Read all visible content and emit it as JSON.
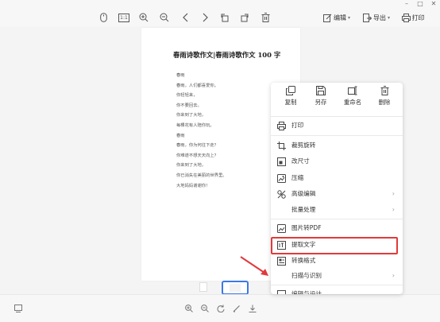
{
  "window": {
    "minimize": "–",
    "maximize": "□",
    "close": "✕"
  },
  "toolbar": {
    "zoom_ratio_label": "1:1",
    "edit_label": "编辑",
    "export_label": "导出",
    "print_label": "打印"
  },
  "document": {
    "title": "春雨诗歌作文|春雨诗歌作文 100 字",
    "poem_lines": [
      "春雨",
      "春雨，人们都喜爱你。",
      "你轻轻来，",
      "你不要回去。",
      "你来到了大地，",
      "每棵花有人陪你玩。",
      "春雨",
      "春雨，你为何往下走？",
      "你难道不想天天向上？",
      "你来到了大地，",
      "你已消失在美丽的世界里。",
      "大地妈妈谢谢你！"
    ]
  },
  "context_menu": {
    "quick_actions": [
      {
        "label": "复制",
        "icon": "copy-icon"
      },
      {
        "label": "另存",
        "icon": "save-icon"
      },
      {
        "label": "重命名",
        "icon": "rename-icon"
      },
      {
        "label": "删除",
        "icon": "trash-icon"
      }
    ],
    "items": [
      {
        "label": "打印",
        "icon": "printer-icon",
        "submenu": false
      },
      {
        "label": "裁剪旋转",
        "icon": "crop-icon",
        "submenu": false
      },
      {
        "label": "改尺寸",
        "icon": "resize-icon",
        "submenu": false
      },
      {
        "label": "压缩",
        "icon": "compress-icon",
        "submenu": false
      },
      {
        "label": "高级编辑",
        "icon": "advanced-edit-icon",
        "submenu": true
      },
      {
        "label": "批量处理",
        "icon": "",
        "submenu": true
      },
      {
        "label": "图片转PDF",
        "icon": "image-to-pdf-icon",
        "submenu": false
      },
      {
        "label": "提取文字",
        "icon": "extract-text-icon",
        "submenu": false,
        "highlighted": true
      },
      {
        "label": "转换格式",
        "icon": "convert-icon",
        "submenu": false
      },
      {
        "label": "扫描与识别",
        "icon": "",
        "submenu": true
      },
      {
        "label": "编辑与设计",
        "icon": "design-icon",
        "submenu": false
      }
    ],
    "highlight_color": "#e03a3a"
  },
  "colors": {
    "accent": "#3b78e7",
    "highlight": "#e03a3a",
    "arrow": "#e03a3a"
  }
}
